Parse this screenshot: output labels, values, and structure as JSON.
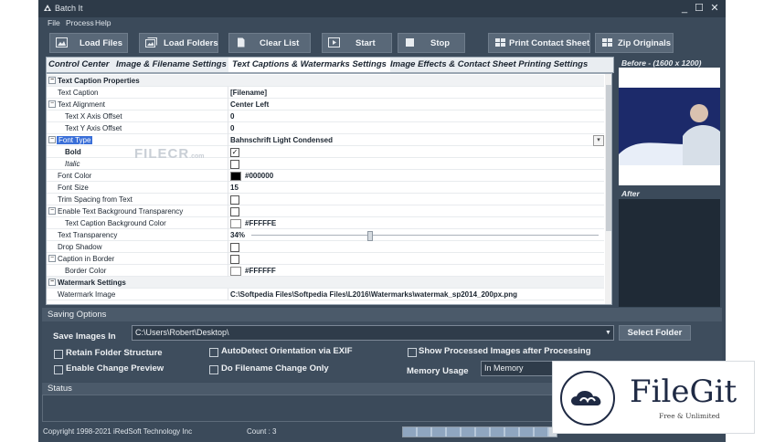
{
  "window": {
    "title": "Batch It",
    "minimize": "_",
    "maximize": "☐",
    "close": "✕"
  },
  "menu": [
    "File",
    "Process",
    "Help"
  ],
  "toolbar": {
    "load_files": "Load Files",
    "load_folders": "Load Folders",
    "clear_list": "Clear List",
    "start": "Start",
    "stop": "Stop",
    "print_contact_sheet": "Print Contact Sheet",
    "zip_originals": "Zip Originals"
  },
  "tabs": {
    "control_center": "Control Center",
    "image_filename": "Image & Filename Settings",
    "text_captions": "Text Captions & Watermarks Settings",
    "image_effects": "Image Effects & Contact Sheet Printing Settings"
  },
  "grid": {
    "cat_caption": "Text Caption Properties",
    "text_caption": {
      "name": "Text Caption",
      "value": "[Filename]"
    },
    "text_alignment": {
      "name": "Text Alignment",
      "value": "Center Left"
    },
    "x_offset": {
      "name": "Text X Axis Offset",
      "value": "0"
    },
    "y_offset": {
      "name": "Text Y Axis Offset",
      "value": "0"
    },
    "font_type": {
      "name": "Font Type",
      "value": "Bahnschrift Light Condensed"
    },
    "bold": {
      "name": "Bold",
      "checked": true
    },
    "italic": {
      "name": "Italic",
      "checked": false
    },
    "font_color": {
      "name": "Font Color",
      "value": "#000000",
      "color": "#000000"
    },
    "font_size": {
      "name": "Font Size",
      "value": "15"
    },
    "trim_spacing": {
      "name": "Trim Spacing from Text",
      "checked": false
    },
    "enable_bg_transparency": {
      "name": "Enable Text Background Transparency",
      "checked": false
    },
    "bg_color": {
      "name": "Text Caption Background Color",
      "value": "#FFFFFE",
      "color": "#FFFFFE"
    },
    "text_transparency": {
      "name": "Text Transparency",
      "value": "34%",
      "level": 0.34
    },
    "drop_shadow": {
      "name": "Drop Shadow",
      "checked": false
    },
    "caption_in_border": {
      "name": "Caption in Border",
      "checked": false
    },
    "border_color": {
      "name": "Border Color",
      "value": "#FFFFFF",
      "color": "#FFFFFF"
    },
    "cat_watermark": "Watermark Settings",
    "watermark_image": {
      "name": "Watermark Image",
      "value": "C:\\Softpedia Files\\Softpedia Files\\L2016\\Watermarks\\watermak_sp2014_200px.png"
    }
  },
  "watermark_overlay": {
    "text": "FILECR",
    "suffix": ".com"
  },
  "preview": {
    "before_label": "Before - (1600 x 1200)",
    "after_label": "After"
  },
  "saving": {
    "section_title": "Saving Options",
    "save_label": "Save Images In",
    "save_path": "C:\\Users\\Robert\\Desktop\\",
    "select_folder": "Select Folder",
    "retain_folder": "Retain Folder Structure",
    "enable_preview": "Enable Change Preview",
    "autodetect": "AutoDetect Orientation via EXIF",
    "filename_only": "Do Filename Change Only",
    "show_processed": "Show Processed Images after Processing",
    "memory_label": "Memory Usage",
    "memory_value": "In Memory"
  },
  "status": {
    "section_title": "Status"
  },
  "footer": {
    "copyright": "Copyright 1998-2021 iRedSoft Technology Inc",
    "count": "Count : 3",
    "progress": 0.95
  },
  "badge": {
    "brand": "FileGit",
    "tagline": "Free & Unlimited"
  }
}
